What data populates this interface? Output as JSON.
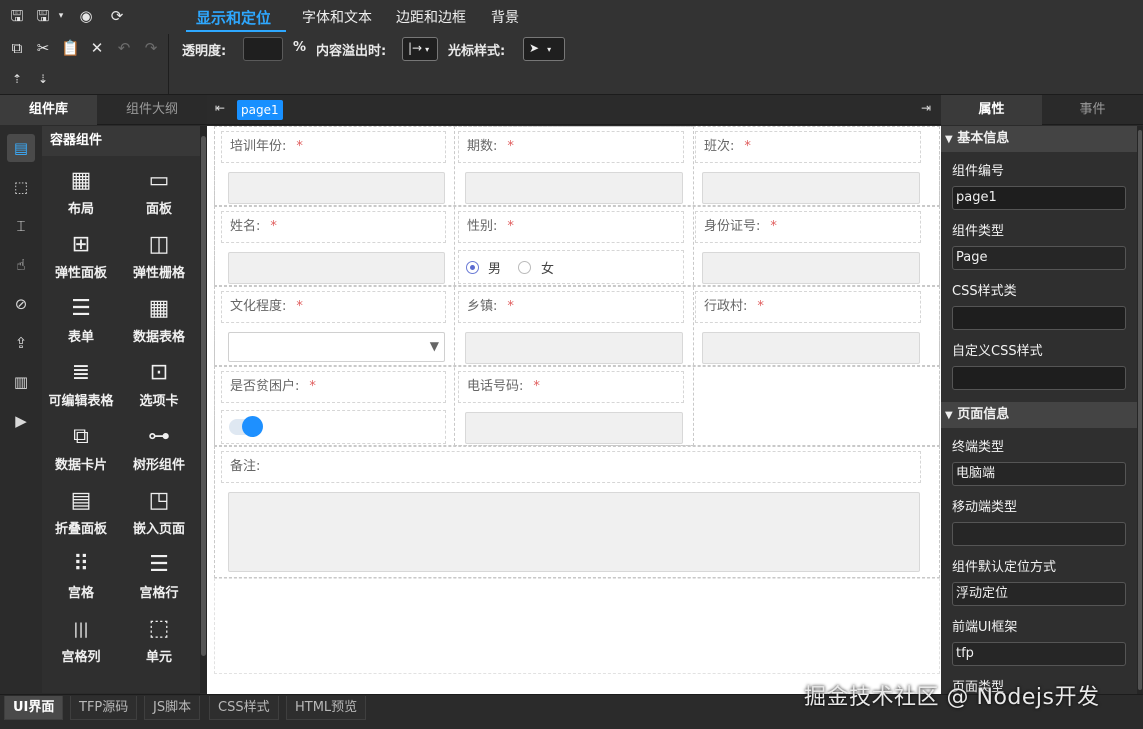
{
  "toolbar": {
    "tabs": [
      "显示和定位",
      "字体和文本",
      "边距和边框",
      "背景"
    ],
    "opacity_label": "透明度:",
    "opacity_value": "",
    "opacity_unit": "%",
    "overflow_label": "内容溢出时:",
    "overflow_icon": "|→",
    "cursor_label": "光标样式:",
    "cursor_icon": "➤"
  },
  "left": {
    "tabs": [
      "组件库",
      "组件大纲"
    ],
    "section_title": "容器组件",
    "components": [
      {
        "label": "布局",
        "icon": "layout-icon",
        "glyph": "▦"
      },
      {
        "label": "面板",
        "icon": "panel-icon",
        "glyph": "▭"
      },
      {
        "label": "弹性面板",
        "icon": "flex-panel-icon",
        "glyph": "⊞"
      },
      {
        "label": "弹性栅格",
        "icon": "flex-grid-icon",
        "glyph": "◫"
      },
      {
        "label": "表单",
        "icon": "form-icon",
        "glyph": "☰"
      },
      {
        "label": "数据表格",
        "icon": "data-table-icon",
        "glyph": "▦"
      },
      {
        "label": "可编辑表格",
        "icon": "editable-table-icon",
        "glyph": "≣"
      },
      {
        "label": "选项卡",
        "icon": "tabs-icon",
        "glyph": "⊡"
      },
      {
        "label": "数据卡片",
        "icon": "data-card-icon",
        "glyph": "⧉"
      },
      {
        "label": "树形组件",
        "icon": "tree-icon",
        "glyph": "⊶"
      },
      {
        "label": "折叠面板",
        "icon": "collapse-panel-icon",
        "glyph": "▤"
      },
      {
        "label": "嵌入页面",
        "icon": "embed-page-icon",
        "glyph": "◳"
      },
      {
        "label": "宫格",
        "icon": "grid-icon",
        "glyph": "⠿"
      },
      {
        "label": "宫格行",
        "icon": "grid-row-icon",
        "glyph": "☰"
      },
      {
        "label": "宫格列",
        "icon": "grid-column-icon",
        "glyph": "|||"
      },
      {
        "label": "单元",
        "icon": "cell-icon",
        "glyph": "⬚"
      }
    ]
  },
  "canvas": {
    "page_tab": "page1",
    "fields": {
      "training_year": "培训年份:",
      "period": "期数:",
      "class_no": "班次:",
      "name": "姓名:",
      "gender": "性别:",
      "id_number": "身份证号:",
      "education": "文化程度:",
      "town": "乡镇:",
      "village": "行政村:",
      "poor_household": "是否贫困户:",
      "phone": "电话号码:",
      "remark": "备注:"
    },
    "required_mark": "*",
    "gender_options": [
      "男",
      "女"
    ],
    "gender_selected": "男",
    "poor_household_value": true
  },
  "right": {
    "tabs": [
      "属性",
      "事件"
    ],
    "basic_section": "基本信息",
    "component_id_label": "组件编号",
    "component_id_value": "page1",
    "component_type_label": "组件类型",
    "component_type_value": "Page",
    "css_class_label": "CSS样式类",
    "css_class_value": "",
    "custom_css_label": "自定义CSS样式",
    "custom_css_value": "",
    "page_section": "页面信息",
    "terminal_type_label": "终端类型",
    "terminal_type_value": "电脑端",
    "mobile_type_label": "移动端类型",
    "mobile_type_value": "",
    "default_position_label": "组件默认定位方式",
    "default_position_value": "浮动定位",
    "ui_framework_label": "前端UI框架",
    "ui_framework_value": "tfp",
    "page_type_label": "页面类型"
  },
  "bottom": {
    "tabs": [
      "UI界面",
      "TFP源码",
      "JS脚本",
      "CSS样式",
      "HTML预览"
    ],
    "active": "UI界面"
  },
  "watermark": "掘金技术社区 @ Nodejs开发",
  "colors": {
    "accent": "#2ea8ff",
    "page_tab": "#1890ff",
    "toggle_on": "#1e90ff",
    "required": "#e05c5c"
  }
}
